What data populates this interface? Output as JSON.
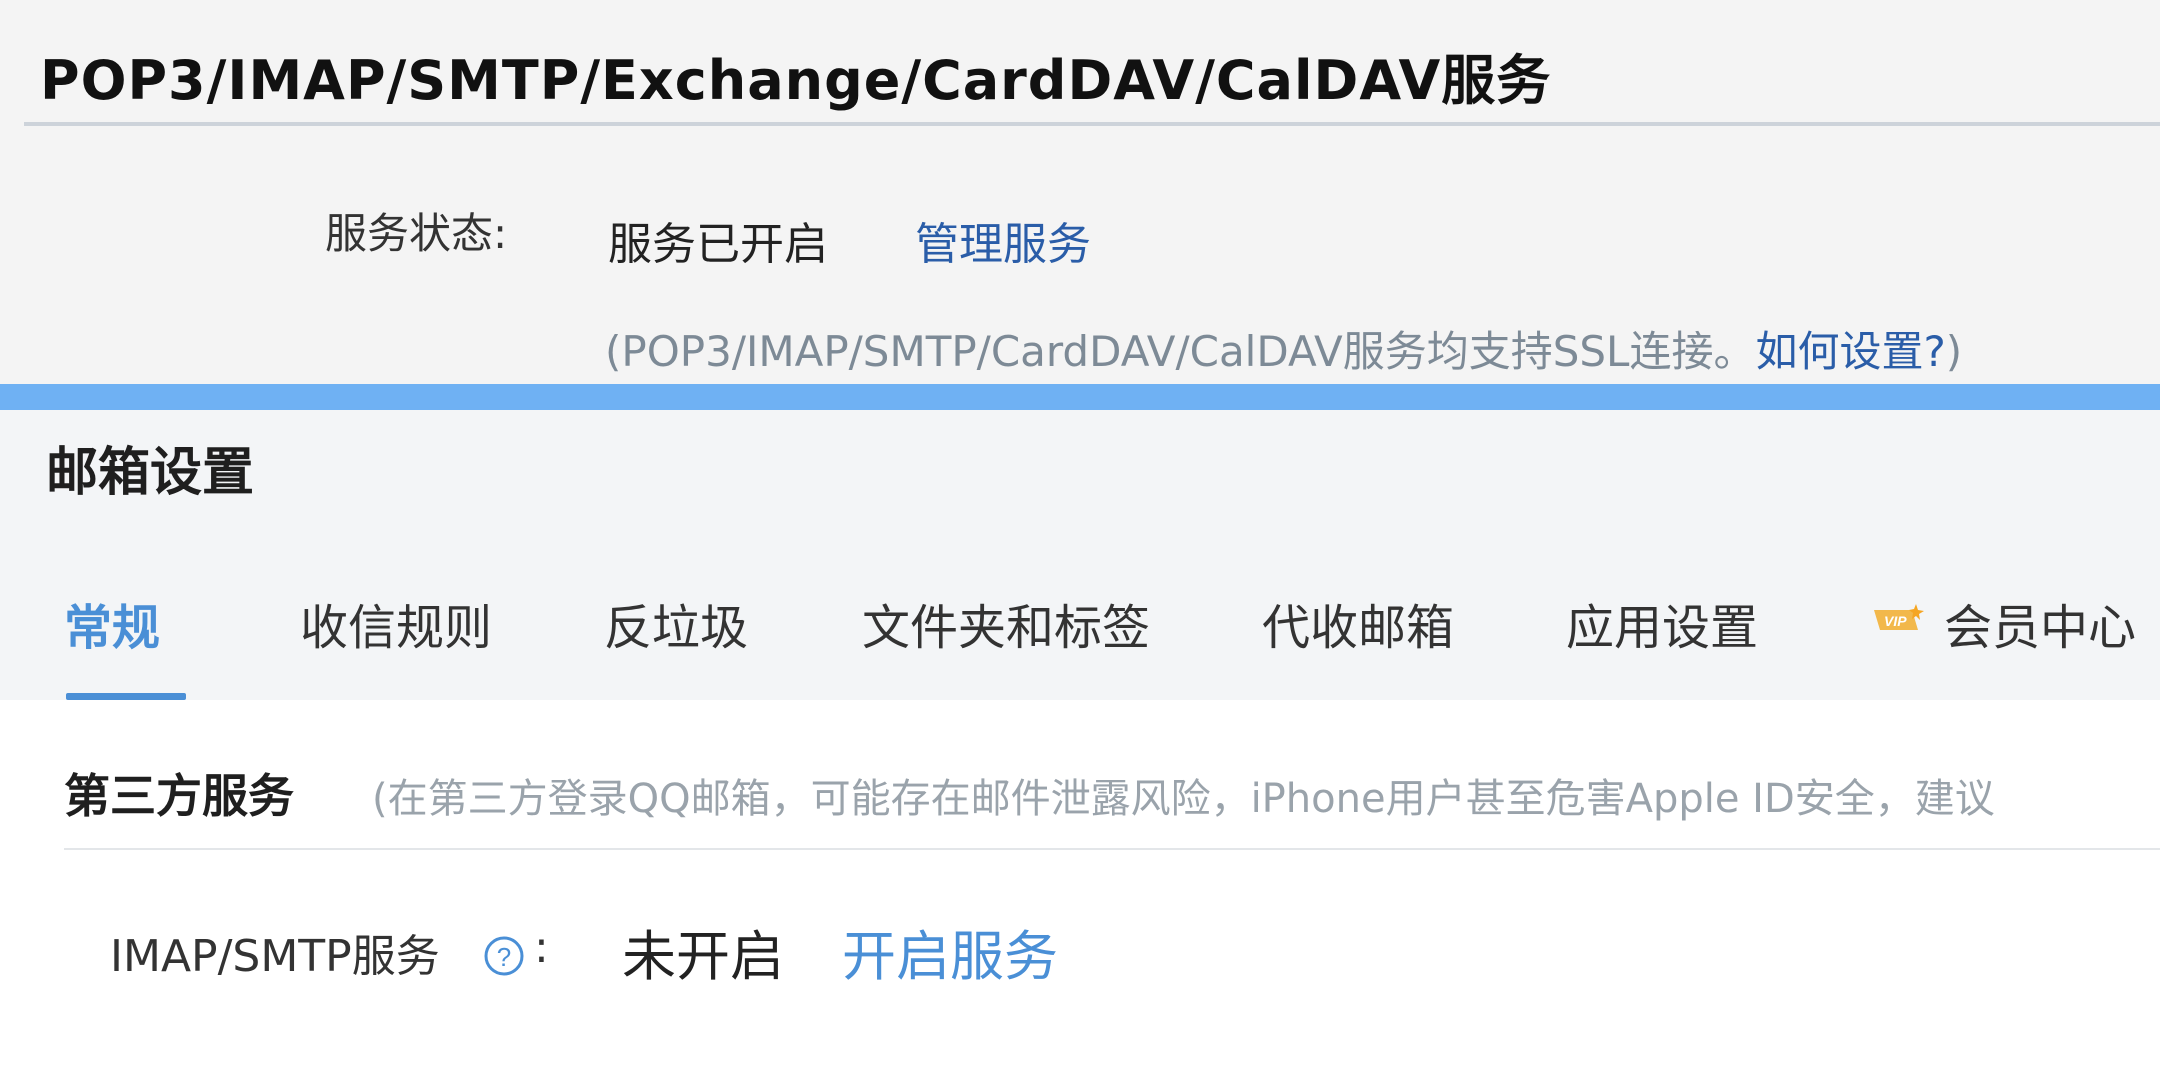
{
  "service_section": {
    "title": "POP3/IMAP/SMTP/Exchange/CardDAV/CalDAV服务",
    "status_label": "服务状态:",
    "status_value": "服务已开启",
    "manage_link": "管理服务",
    "ssl_note": "(POP3/IMAP/SMTP/CardDAV/CalDAV服务均支持SSL连接。",
    "ssl_help_link": "如何设置?",
    "ssl_note_close": ")"
  },
  "mailbox_settings": {
    "title": "邮箱设置",
    "tabs": [
      {
        "label": "常规",
        "active": true
      },
      {
        "label": "收信规则",
        "active": false
      },
      {
        "label": "反垃圾",
        "active": false
      },
      {
        "label": "文件夹和标签",
        "active": false
      },
      {
        "label": "代收邮箱",
        "active": false
      },
      {
        "label": "应用设置",
        "active": false
      },
      {
        "label": "会员中心",
        "active": false,
        "badge": "VIP"
      }
    ]
  },
  "third_party": {
    "title": "第三方服务",
    "note": "(在第三方登录QQ邮箱，可能存在邮件泄露风险，iPhone用户甚至危害Apple ID安全，建议",
    "imap_label": "IMAP/SMTP服务",
    "help_icon": "question-circle-icon",
    "colon": ":",
    "status": "未开启",
    "enable_link": "开启服务"
  },
  "colors": {
    "accent": "#4a8fd6",
    "link": "#2a5da8",
    "band": "#6fb1f3",
    "muted": "#9aa3ab"
  }
}
